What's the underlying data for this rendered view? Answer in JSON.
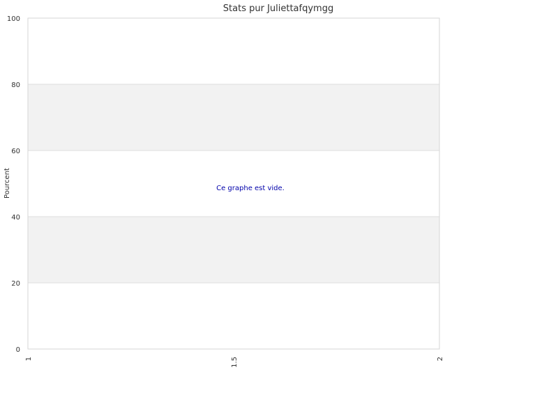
{
  "chart_data": {
    "type": "bar",
    "title": "Stats pur Juliettafqymgg",
    "xlabel": "",
    "ylabel": "Pourcent",
    "ylim": [
      0,
      100
    ],
    "yticks": [
      "0",
      "20",
      "40",
      "60",
      "80",
      "100"
    ],
    "xlim": [
      1,
      2
    ],
    "xticks": [
      "1",
      "1.5",
      "2"
    ],
    "series": [],
    "empty_message": "Ce graphe est vide.",
    "grid": "horizontal alternating bands",
    "colors": {
      "band": "#f2f2f2",
      "grid_line": "#dddddd",
      "frame": "#d6d6d6",
      "empty_message": "#0000aa"
    }
  }
}
